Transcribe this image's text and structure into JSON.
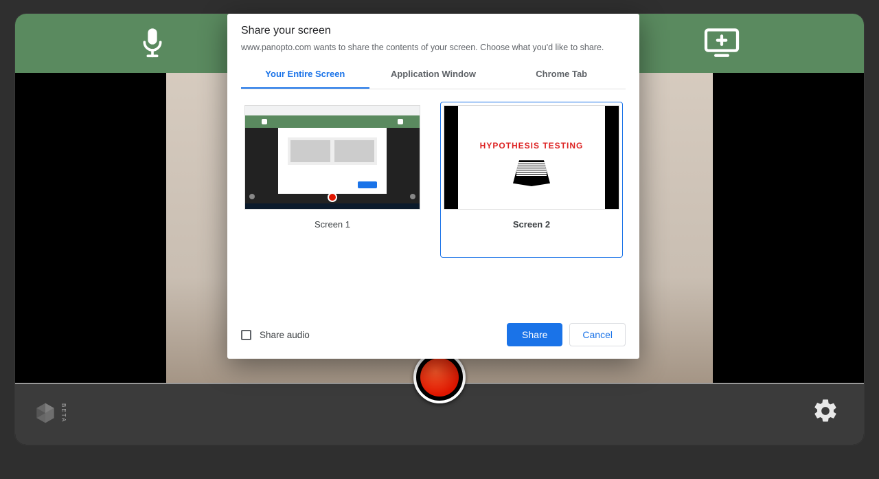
{
  "dialog": {
    "title": "Share your screen",
    "subtitle": "www.panopto.com wants to share the contents of your screen. Choose what you'd like to share.",
    "tabs": {
      "entire": "Your Entire Screen",
      "window": "Application Window",
      "tab": "Chrome Tab"
    },
    "screens": {
      "s1": "Screen 1",
      "s2": "Screen 2",
      "s2_slide_title": "HYPOTHESIS TESTING"
    },
    "share_audio": "Share audio",
    "share_btn": "Share",
    "cancel_btn": "Cancel",
    "selected_screen": "s2",
    "active_tab": "entire"
  },
  "app": {
    "beta_label": "BETA"
  }
}
